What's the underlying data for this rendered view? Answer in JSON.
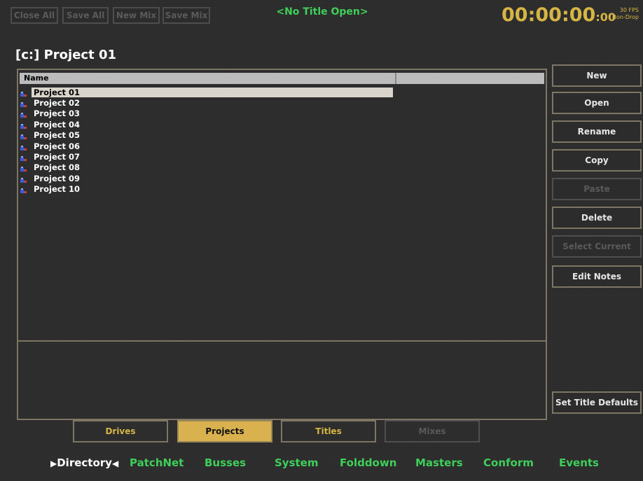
{
  "top_buttons": [
    "Close All",
    "Save All",
    "New Mix",
    "Save Mix"
  ],
  "title_status": "<No Title Open>",
  "timecode": {
    "main": "00:00:00",
    "frames": ":00",
    "fps": "30 FPS",
    "mode": "Non-Drop"
  },
  "project_title": "[c:] Project 01",
  "list": {
    "column_name": "Name",
    "items": [
      "Project 01",
      "Project 02",
      "Project 03",
      "Project 04",
      "Project 05",
      "Project 06",
      "Project 07",
      "Project 08",
      "Project 09",
      "Project 10"
    ]
  },
  "side_buttons": {
    "new": "New",
    "open": "Open",
    "rename": "Rename",
    "copy": "Copy",
    "paste": "Paste",
    "delete": "Delete",
    "select_current": "Select Current",
    "edit_notes": "Edit Notes",
    "set_title_defaults": "Set Title Defaults"
  },
  "view_tabs": [
    "Drives",
    "Projects",
    "Titles",
    "Mixes"
  ],
  "nav": [
    "Directory",
    "PatchNet",
    "Busses",
    "System",
    "Folddown",
    "Masters",
    "Conform",
    "Events"
  ],
  "colors": {
    "accent_green": "#3fcf5a",
    "accent_gold": "#d6b545",
    "border": "#7e7664"
  }
}
